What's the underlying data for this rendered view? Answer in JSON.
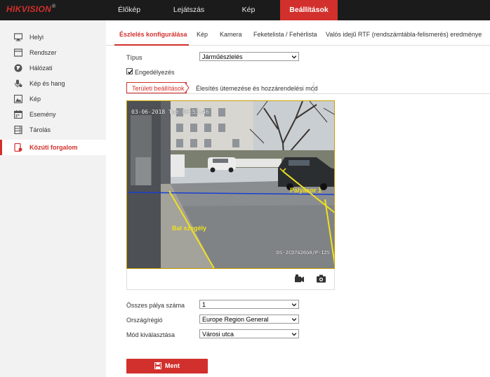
{
  "brand": {
    "logo": "HIKVISION",
    "reg": "®"
  },
  "topnav": [
    "Élőkép",
    "Lejátszás",
    "Kép",
    "Beállítások"
  ],
  "sidebar": [
    "Helyi",
    "Rendszer",
    "Hálózati",
    "Kép és hang",
    "Kép",
    "Esemény",
    "Tárolás",
    "Közúti forgalom"
  ],
  "tabs": [
    "Észlelés konfigurálása",
    "Kép",
    "Kamera",
    "Feketelista / Fehérlista",
    "Valós idejű RTF (rendszámtábla-felismerés) eredménye"
  ],
  "form": {
    "type_label": "Típus",
    "type_value": "Járműészlelés",
    "enable_label": "Engedélyezés",
    "lanes_label": "Összes pálya száma",
    "lanes_value": "1",
    "country_label": "Ország/régió",
    "country_value": "Europe Region General",
    "mode_label": "Mód kiválasztása",
    "mode_value": "Városi utca"
  },
  "subtabs": [
    "Területi beállítások",
    "Élesítés ütemezése és hozzárendelési mód"
  ],
  "video": {
    "timestamp": "03-06-2018 Tue 09:53:46",
    "device": "DS-2CD7A26G0/P-IZS",
    "lane_label": "Pályasor 1",
    "edge_label": "Bal szegély"
  },
  "save_label": "Ment",
  "colors": {
    "accent": "#d2302c",
    "topbar": "#1b1b1b",
    "sidebar": "#f2f2f2",
    "lane_line": "#f0e020"
  }
}
